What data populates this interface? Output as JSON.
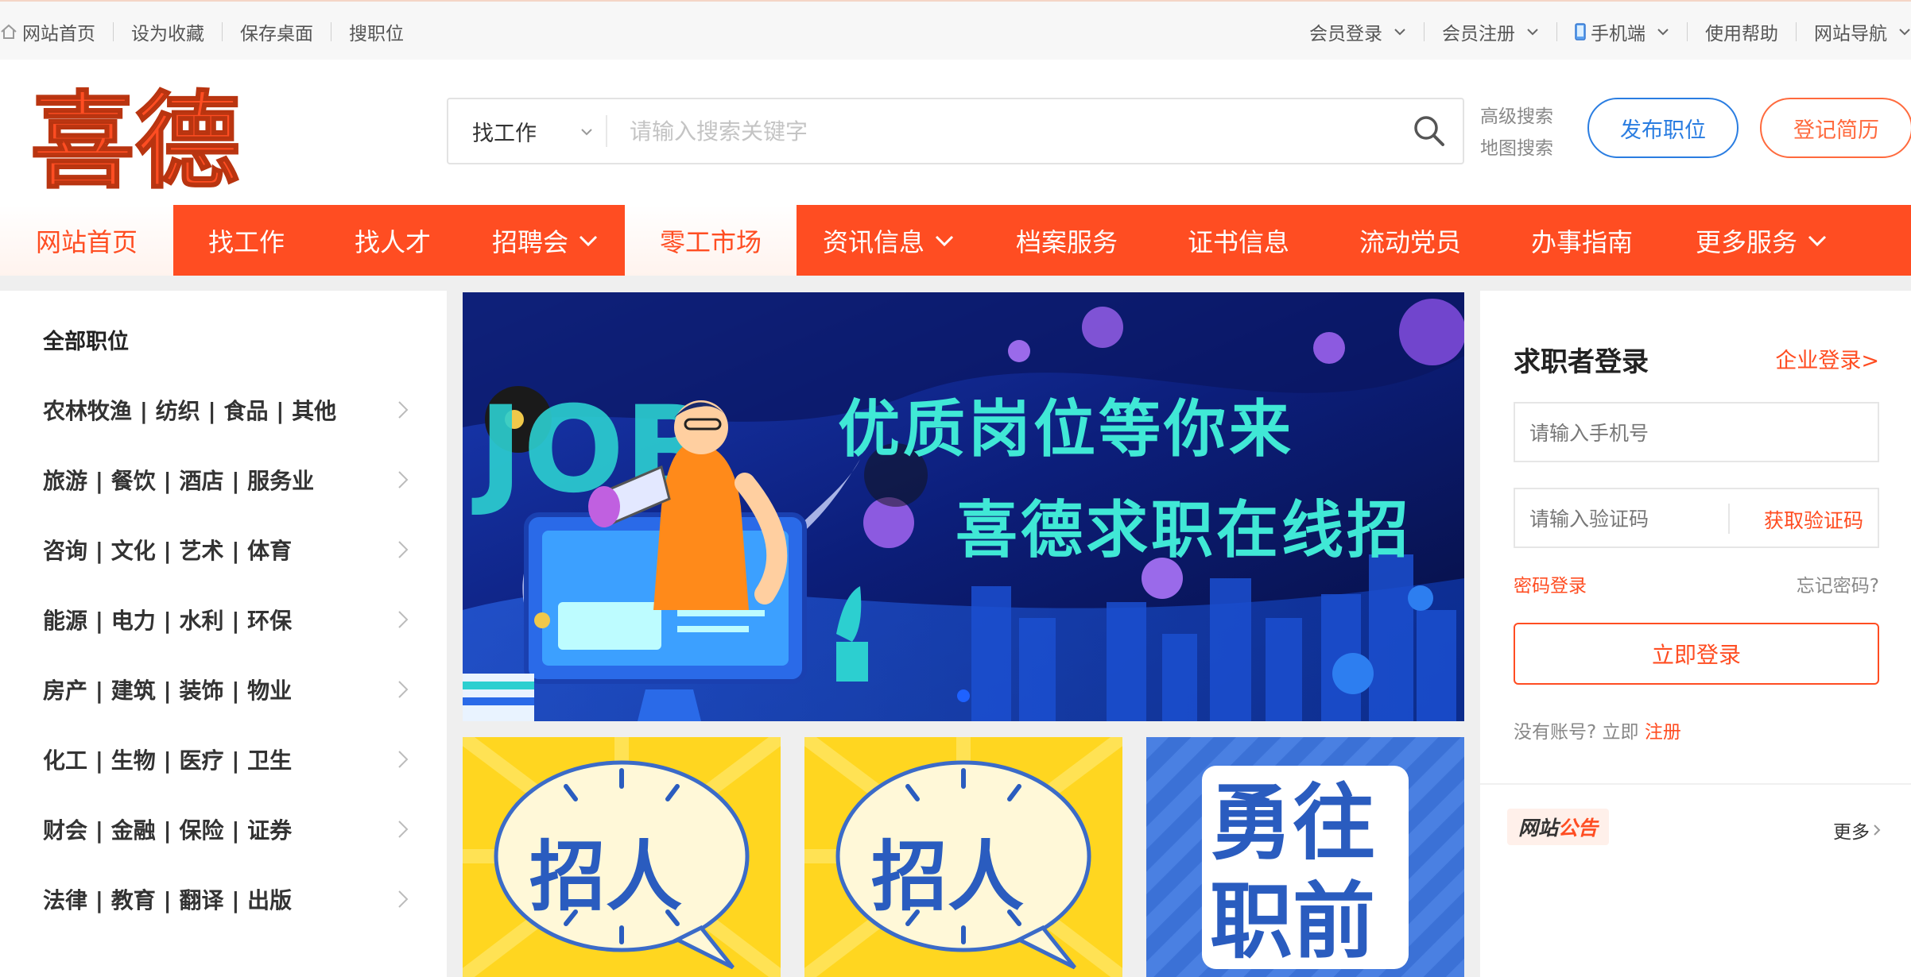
{
  "topbar": {
    "left": [
      "网站首页",
      "设为收藏",
      "保存桌面",
      "搜职位"
    ],
    "right": [
      "会员登录",
      "会员注册",
      "手机端",
      "使用帮助",
      "网站导航"
    ]
  },
  "header": {
    "logo_text": "喜德",
    "search_type": "找工作",
    "search_placeholder": "请输入搜索关键字",
    "advanced_search": "高级搜索",
    "map_search": "地图搜索",
    "post_job": "发布职位",
    "register_resume": "登记简历"
  },
  "nav": {
    "items": [
      "网站首页",
      "找工作",
      "找人才",
      "招聘会",
      "零工市场",
      "资讯信息",
      "档案服务",
      "证书信息",
      "流动党员",
      "办事指南",
      "更多服务"
    ],
    "active_index": 0,
    "highlight_index": 4
  },
  "sidebar": {
    "title": "全部职位",
    "items": [
      "农林牧渔 | 纺织 | 食品 | 其他",
      "旅游 | 餐饮 | 酒店 | 服务业",
      "咨询 | 文化 | 艺术 | 体育",
      "能源 | 电力 | 水利 | 环保",
      "房产 | 建筑 | 装饰 | 物业",
      "化工 | 生物 | 医疗 | 卫生",
      "财会 | 金融 | 保险 | 证券",
      "法律 | 教育 | 翻译 | 出版"
    ]
  },
  "banner": {
    "line1": "优质岗位等你来",
    "line2": "喜德求职在线招",
    "job_text": "JOB"
  },
  "tiles": [
    {
      "text": "招人"
    },
    {
      "text": "招人"
    },
    {
      "line1": "勇往",
      "line2": "职前"
    }
  ],
  "login": {
    "title": "求职者登录",
    "enterprise_link": "企业登录>",
    "phone_placeholder": "请输入手机号",
    "code_placeholder": "请输入验证码",
    "get_code": "获取验证码",
    "password_login": "密码登录",
    "forgot": "忘记密码?",
    "submit": "立即登录",
    "no_account": "没有账号? 立即",
    "register": "注册"
  },
  "notice": {
    "badge_part1": "网站",
    "badge_part2": "公告",
    "more": "更多"
  },
  "colors": {
    "brand": "#ff4d22",
    "blue": "#2a7de1",
    "banner_text": "#40e8d6"
  }
}
